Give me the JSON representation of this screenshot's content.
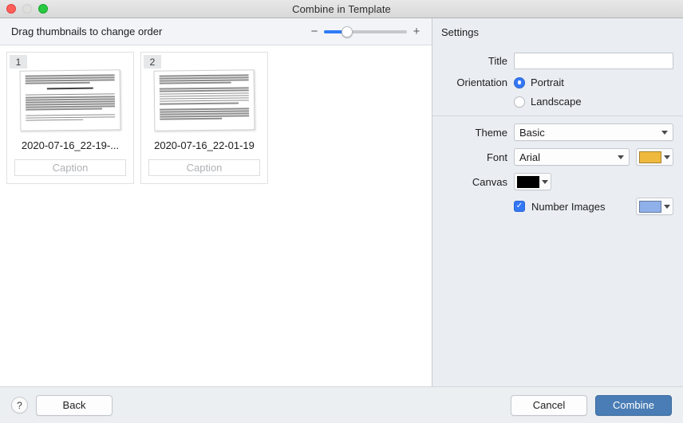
{
  "window": {
    "title": "Combine in Template",
    "traffic_lights": [
      "close",
      "minimize",
      "maximize"
    ]
  },
  "left_pane": {
    "toolbar": {
      "drag_hint": "Drag thumbnails to change order",
      "zoom_out_label": "−",
      "zoom_in_label": "+",
      "zoom_value_percent": 28
    },
    "thumbnails": [
      {
        "index": "1",
        "filename": "2020-07-16_22-19-...",
        "caption_placeholder": "Caption",
        "caption_value": ""
      },
      {
        "index": "2",
        "filename": "2020-07-16_22-01-19",
        "caption_placeholder": "Caption",
        "caption_value": ""
      }
    ]
  },
  "settings": {
    "header": "Settings",
    "title_label": "Title",
    "title_value": "",
    "title_placeholder": "",
    "orientation_label": "Orientation",
    "orientation_options": [
      {
        "label": "Portrait",
        "selected": true
      },
      {
        "label": "Landscape",
        "selected": false
      }
    ],
    "theme_label": "Theme",
    "theme_value": "Basic",
    "font_label": "Font",
    "font_value": "Arial",
    "font_color": "#efb93d",
    "canvas_label": "Canvas",
    "canvas_color": "#000000",
    "number_images_label": "Number Images",
    "number_images_checked": true,
    "number_images_check_glyph": "✓",
    "number_images_color": "#8fb0e8"
  },
  "footer": {
    "help_label": "?",
    "back_label": "Back",
    "cancel_label": "Cancel",
    "combine_label": "Combine"
  },
  "colors": {
    "accent_blue": "#3478f6",
    "primary_button": "#4a7db5",
    "settings_bg": "#eaeef2"
  }
}
